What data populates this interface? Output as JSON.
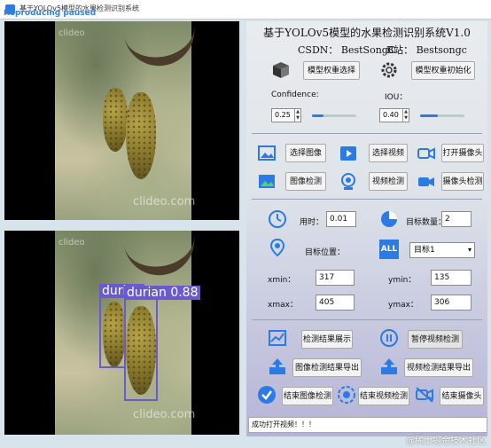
{
  "window": {
    "title": "基于YOLOv5模型的水果检测识别系统",
    "overlay_label": "Reproducing paused"
  },
  "left": {
    "top_watermark": "clideo.com",
    "bottom_watermark": "clideo.com",
    "top_logo": "clideo",
    "bottom_logo": "clideo",
    "detections": [
      {
        "label": "durian",
        "confidence": ""
      },
      {
        "label": "durian",
        "confidence": "0.88"
      }
    ]
  },
  "header": {
    "title": "基于YOLOv5模型的水果检测识别系统V1.0",
    "csdn": "CSDN：  BestSongC",
    "bilibili": "B站：  Bestsongc"
  },
  "model": {
    "select_label": "模型权重选择",
    "init_label": "模型权重初始化"
  },
  "params": {
    "confidence_label": "Confidence:",
    "confidence_value": "0.25",
    "confidence_fill": 0.25,
    "iou_label": "IOU：",
    "iou_value": "0.40",
    "iou_fill": 0.4
  },
  "actions": {
    "select_image": "选择图像",
    "select_video": "选择视频",
    "open_camera": "打开摄像头",
    "image_detect": "图像检测",
    "video_detect": "视频检测",
    "camera_detect": "摄像头检测"
  },
  "results": {
    "time_label": "用时：",
    "time_value": "0.01",
    "count_label": "目标数量：",
    "count_value": "2",
    "position_label": "目标位置：",
    "target_select": "目标1",
    "xmin_label": "xmin：",
    "xmin_value": "317",
    "ymin_label": "ymin：",
    "ymin_value": "135",
    "xmax_label": "xmax：",
    "xmax_value": "405",
    "ymax_label": "ymax：",
    "ymax_value": "306"
  },
  "bottom": {
    "show_results": "检测结果展示",
    "pause_video": "暂停视频检测",
    "export_image": "图像检测结果导出",
    "export_video": "视频检测结果导出",
    "end_image": "结束图像检测",
    "end_video": "结束视频检测",
    "end_camera": "结束摄像头"
  },
  "status": {
    "message": "成功打开视频！！！"
  },
  "corner_watermark": "@稀土掘金技术社区",
  "colors": {
    "accent": "#2c7be5",
    "detection_box": "#6a5acd"
  }
}
